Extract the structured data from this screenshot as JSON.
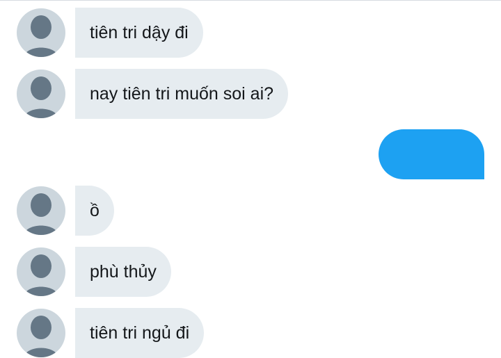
{
  "conversation": {
    "messages": [
      {
        "sender": "other",
        "text": "tiên tri dậy đi"
      },
      {
        "sender": "other",
        "text": "nay tiên tri muốn soi ai?"
      },
      {
        "sender": "self",
        "text": ""
      },
      {
        "sender": "other",
        "text": "ồ"
      },
      {
        "sender": "other",
        "text": "phù thủy"
      },
      {
        "sender": "other",
        "text": "tiên tri ngủ đi"
      }
    ]
  },
  "colors": {
    "incoming_bubble": "#e6ecf0",
    "outgoing_bubble": "#1da1f2",
    "avatar_bg": "#ccd6dd",
    "avatar_icon": "#657786",
    "text": "#14171a"
  },
  "icons": {
    "avatar": "default-profile-icon"
  }
}
